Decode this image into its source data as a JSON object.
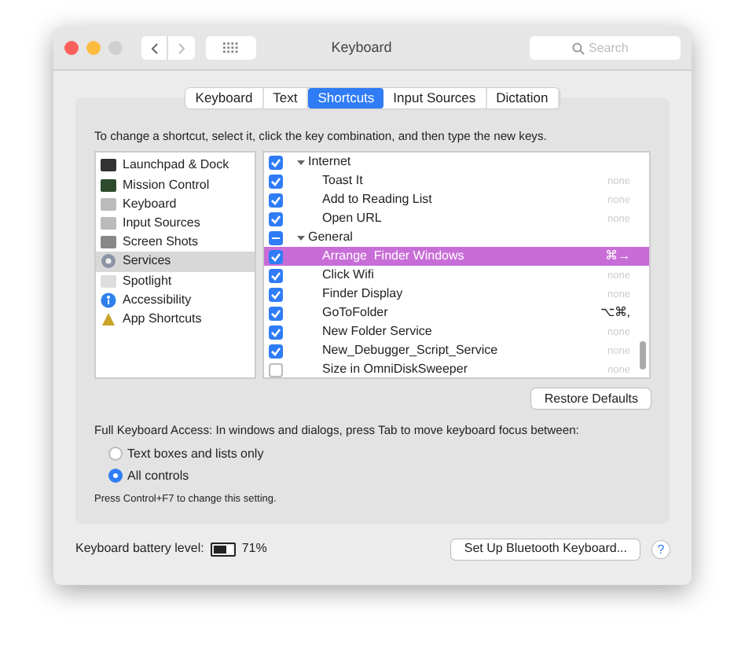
{
  "window": {
    "title": "Keyboard"
  },
  "search": {
    "placeholder": "Search"
  },
  "tabs": [
    {
      "label": "Keyboard",
      "selected": false
    },
    {
      "label": "Text",
      "selected": false
    },
    {
      "label": "Shortcuts",
      "selected": true
    },
    {
      "label": "Input Sources",
      "selected": false
    },
    {
      "label": "Dictation",
      "selected": false
    }
  ],
  "instructions": "To change a shortcut, select it, click the key combination, and then type the new keys.",
  "categories": [
    {
      "label": "Launchpad & Dock",
      "selected": false
    },
    {
      "label": "Mission Control",
      "selected": false
    },
    {
      "label": "Keyboard",
      "selected": false
    },
    {
      "label": "Input Sources",
      "selected": false
    },
    {
      "label": "Screen Shots",
      "selected": false
    },
    {
      "label": "Services",
      "selected": true
    },
    {
      "label": "Spotlight",
      "selected": false
    },
    {
      "label": "Accessibility",
      "selected": false
    },
    {
      "label": "App Shortcuts",
      "selected": false
    }
  ],
  "shortcuts": [
    {
      "kind": "group",
      "label": "Internet",
      "checked": true,
      "mixed": false,
      "selected": false
    },
    {
      "kind": "item",
      "label": "Toast It",
      "shortcut": "none",
      "checked": true,
      "mixed": false,
      "selected": false
    },
    {
      "kind": "item",
      "label": "Add to Reading List",
      "shortcut": "none",
      "checked": true,
      "mixed": false,
      "selected": false
    },
    {
      "kind": "item",
      "label": "Open URL",
      "shortcut": "none",
      "checked": true,
      "mixed": false,
      "selected": false
    },
    {
      "kind": "group",
      "label": "General",
      "checked": true,
      "mixed": true,
      "selected": false
    },
    {
      "kind": "item",
      "label": "Arrange  Finder Windows",
      "shortcut": "⌘→",
      "checked": true,
      "mixed": false,
      "selected": true
    },
    {
      "kind": "item",
      "label": "Click Wifi",
      "shortcut": "none",
      "checked": true,
      "mixed": false,
      "selected": false
    },
    {
      "kind": "item",
      "label": "Finder Display",
      "shortcut": "none",
      "checked": true,
      "mixed": false,
      "selected": false
    },
    {
      "kind": "item",
      "label": "GoToFolder",
      "shortcut": "⌥⌘,",
      "checked": true,
      "mixed": false,
      "selected": false
    },
    {
      "kind": "item",
      "label": "New Folder Service",
      "shortcut": "none",
      "checked": true,
      "mixed": false,
      "selected": false
    },
    {
      "kind": "item",
      "label": "New_Debugger_Script_Service",
      "shortcut": "none",
      "checked": true,
      "mixed": false,
      "selected": false
    },
    {
      "kind": "item",
      "label": "Size in OmniDiskSweeper",
      "shortcut": "none",
      "checked": false,
      "mixed": false,
      "selected": false
    }
  ],
  "restore_button": "Restore Defaults",
  "full_keyboard_access": {
    "label": "Full Keyboard Access: In windows and dialogs, press Tab to move keyboard focus between:",
    "options": [
      {
        "label": "Text boxes and lists only",
        "selected": false
      },
      {
        "label": "All controls",
        "selected": true
      }
    ],
    "hint": "Press Control+F7 to change this setting."
  },
  "battery": {
    "label": "Keyboard battery level:",
    "level": 0.71,
    "reading": "71%"
  },
  "bluetooth_button": "Set Up Bluetooth Keyboard...",
  "help_button": "?"
}
